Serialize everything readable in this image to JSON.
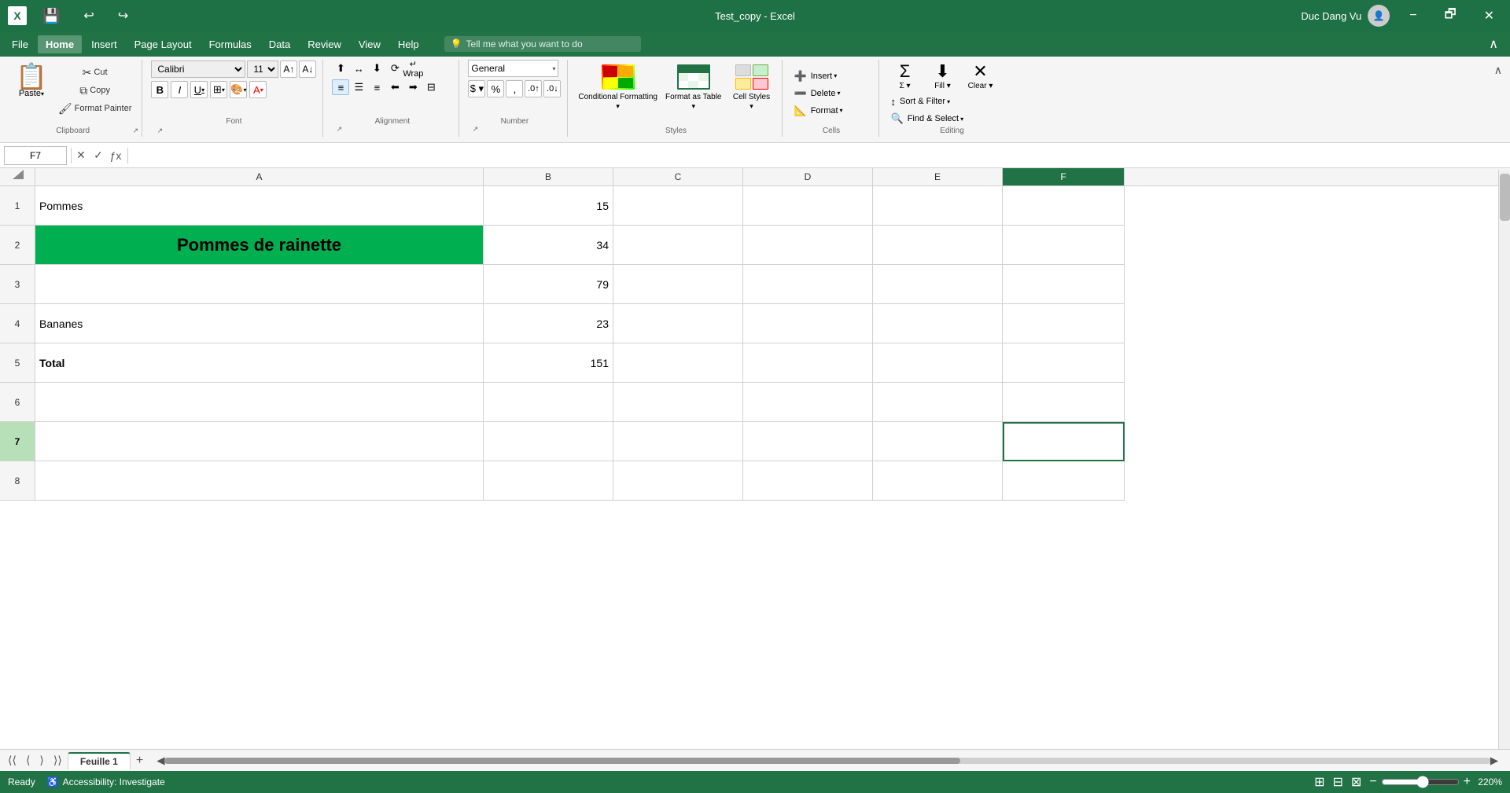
{
  "titleBar": {
    "appIcon": "X",
    "saveIcon": "💾",
    "filename": "Test_copy - Excel",
    "userName": "Duc Dang Vu",
    "minimizeLabel": "−",
    "maximizeLabel": "🗗",
    "closeLabel": "✕"
  },
  "menuBar": {
    "items": [
      "File",
      "Home",
      "Insert",
      "Page Layout",
      "Formulas",
      "Data",
      "Review",
      "View",
      "Help"
    ],
    "activeItem": "Home",
    "searchPlaceholder": "Tell me what you want to do",
    "searchIcon": "💡"
  },
  "ribbon": {
    "clipboard": {
      "label": "Clipboard",
      "pasteLabel": "Paste",
      "cutLabel": "Cut",
      "copyLabel": "Copy",
      "formatPainterLabel": "Format Painter"
    },
    "font": {
      "label": "Font",
      "fontName": "Calibri",
      "fontSize": "11",
      "increaseFontLabel": "A",
      "decreaseFontLabel": "A",
      "boldLabel": "B",
      "italicLabel": "I",
      "underlineLabel": "U",
      "borderLabel": "⊞",
      "fillColorLabel": "🎨",
      "fontColorLabel": "A"
    },
    "alignment": {
      "label": "Alignment",
      "topAlignLabel": "≡",
      "middleAlignLabel": "≡",
      "bottomAlignLabel": "≡",
      "orientLabel": "⟳",
      "wrapLabel": "↵",
      "leftAlignLabel": "≡",
      "centerAlignLabel": "≡",
      "rightAlignLabel": "≡",
      "decreaseIndentLabel": "←",
      "increaseIndentLabel": "→",
      "mergeLabel": "⊞"
    },
    "number": {
      "label": "Number",
      "format": "General",
      "percentLabel": "%",
      "commaLabel": ",",
      "decimalIncLabel": ".0",
      "decimalDecLabel": ".00",
      "currencyLabel": "$"
    },
    "styles": {
      "label": "Styles",
      "conditionalFormattingLabel": "Conditional Formatting",
      "formatAsTableLabel": "Format as Table",
      "cellStylesLabel": "Cell Styles"
    },
    "cells": {
      "label": "Cells",
      "insertLabel": "Insert",
      "deleteLabel": "Delete",
      "formatLabel": "Format"
    },
    "editing": {
      "label": "Editing",
      "sumLabel": "Σ",
      "fillLabel": "⬇",
      "clearLabel": "✕",
      "sortFilterLabel": "Sort & Filter",
      "findSelectLabel": "Find & Select"
    }
  },
  "formulaBar": {
    "nameBox": "F7",
    "cancelLabel": "✕",
    "enterLabel": "✓",
    "functionLabel": "ƒx",
    "formula": ""
  },
  "columns": {
    "rowHeader": "",
    "headers": [
      "A",
      "B",
      "C",
      "D",
      "E",
      "F"
    ]
  },
  "rows": [
    {
      "num": "1",
      "cells": [
        {
          "id": "A1",
          "value": "Pommes",
          "style": "normal"
        },
        {
          "id": "B1",
          "value": "15",
          "style": "number"
        },
        {
          "id": "C1",
          "value": "",
          "style": "normal"
        },
        {
          "id": "D1",
          "value": "",
          "style": "normal"
        },
        {
          "id": "E1",
          "value": "",
          "style": "normal"
        },
        {
          "id": "F1",
          "value": "",
          "style": "normal"
        }
      ]
    },
    {
      "num": "2",
      "cells": [
        {
          "id": "A2",
          "value": "Pommes de rainette",
          "style": "green-bg"
        },
        {
          "id": "B2",
          "value": "34",
          "style": "number"
        },
        {
          "id": "C2",
          "value": "",
          "style": "normal"
        },
        {
          "id": "D2",
          "value": "",
          "style": "normal"
        },
        {
          "id": "E2",
          "value": "",
          "style": "normal"
        },
        {
          "id": "F2",
          "value": "",
          "style": "normal"
        }
      ]
    },
    {
      "num": "3",
      "cells": [
        {
          "id": "A3",
          "value": "",
          "style": "normal"
        },
        {
          "id": "B3",
          "value": "79",
          "style": "number"
        },
        {
          "id": "C3",
          "value": "",
          "style": "normal"
        },
        {
          "id": "D3",
          "value": "",
          "style": "normal"
        },
        {
          "id": "E3",
          "value": "",
          "style": "normal"
        },
        {
          "id": "F3",
          "value": "",
          "style": "normal"
        }
      ]
    },
    {
      "num": "4",
      "cells": [
        {
          "id": "A4",
          "value": "Bananes",
          "style": "normal"
        },
        {
          "id": "B4",
          "value": "23",
          "style": "number"
        },
        {
          "id": "C4",
          "value": "",
          "style": "normal"
        },
        {
          "id": "D4",
          "value": "",
          "style": "normal"
        },
        {
          "id": "E4",
          "value": "",
          "style": "normal"
        },
        {
          "id": "F4",
          "value": "",
          "style": "normal"
        }
      ]
    },
    {
      "num": "5",
      "cells": [
        {
          "id": "A5",
          "value": "Total",
          "style": "bold"
        },
        {
          "id": "B5",
          "value": "151",
          "style": "number"
        },
        {
          "id": "C5",
          "value": "",
          "style": "normal"
        },
        {
          "id": "D5",
          "value": "",
          "style": "normal"
        },
        {
          "id": "E5",
          "value": "",
          "style": "normal"
        },
        {
          "id": "F5",
          "value": "",
          "style": "normal"
        }
      ]
    },
    {
      "num": "6",
      "cells": [
        {
          "id": "A6",
          "value": "",
          "style": "normal"
        },
        {
          "id": "B6",
          "value": "",
          "style": "normal"
        },
        {
          "id": "C6",
          "value": "",
          "style": "normal"
        },
        {
          "id": "D6",
          "value": "",
          "style": "normal"
        },
        {
          "id": "E6",
          "value": "",
          "style": "normal"
        },
        {
          "id": "F6",
          "value": "",
          "style": "normal"
        }
      ]
    },
    {
      "num": "7",
      "cells": [
        {
          "id": "A7",
          "value": "",
          "style": "normal"
        },
        {
          "id": "B7",
          "value": "",
          "style": "normal"
        },
        {
          "id": "C7",
          "value": "",
          "style": "normal"
        },
        {
          "id": "D7",
          "value": "",
          "style": "normal"
        },
        {
          "id": "E7",
          "value": "",
          "style": "normal"
        },
        {
          "id": "F7",
          "value": "",
          "style": "selected"
        }
      ]
    }
  ],
  "sheetTabs": {
    "sheets": [
      "Feuille 1"
    ],
    "activeSheet": "Feuille 1",
    "addLabel": "+"
  },
  "statusBar": {
    "ready": "Ready",
    "accessibility": "Accessibility: Investigate",
    "zoomOut": "−",
    "zoomIn": "+",
    "zoomLevel": "220%",
    "normalViewLabel": "⊞",
    "pageLayoutLabel": "⊟",
    "pageBreakLabel": "⊠"
  }
}
